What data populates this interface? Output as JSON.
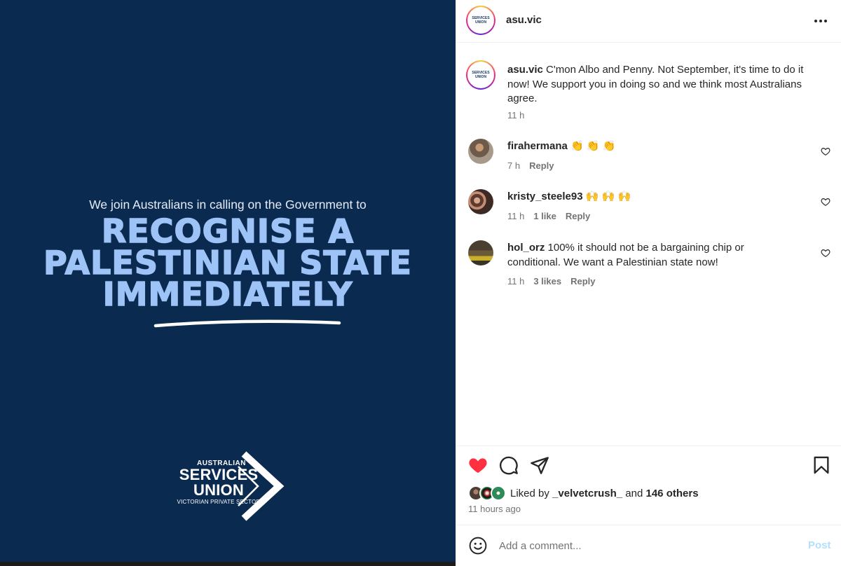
{
  "image": {
    "intro": "We join Australians in calling on the Government to",
    "headline": [
      "RECOGNISE A",
      "PALESTINIAN STATE",
      "IMMEDIATELY"
    ],
    "logo": {
      "line1": "AUSTRALIAN",
      "line2": "SERVICES",
      "line3": "UNION",
      "line4": "VICTORIAN PRIVATE SECTOR"
    },
    "colors": {
      "background": "#0b2a4f",
      "headline": "#9ec3f7"
    }
  },
  "header": {
    "username": "asu.vic",
    "more_icon": "more-horizontal-icon"
  },
  "caption": {
    "username": "asu.vic",
    "text": "C'mon Albo and Penny. Not September, it's time to do it now! We support you in doing so and we think most Australians agree.",
    "time": "11 h"
  },
  "comments": [
    {
      "username": "firahermana",
      "text": "👏 👏 👏",
      "time": "7 h",
      "likes": "",
      "reply": "Reply"
    },
    {
      "username": "kristy_steele93",
      "text": "🙌 🙌 🙌",
      "time": "11 h",
      "likes": "1 like",
      "reply": "Reply"
    },
    {
      "username": "hol_orz",
      "text": "100% it should not be a bargaining chip or conditional. We want a Palestinian state now!",
      "time": "11 h",
      "likes": "3 likes",
      "reply": "Reply"
    }
  ],
  "actions": {
    "liked_by_prefix": "Liked by",
    "liked_by_user": "_velvetcrush_",
    "liked_by_and": "and",
    "liked_by_others": "146 others",
    "time_ago": "11 hours ago",
    "like_color": "#ff3040"
  },
  "composer": {
    "placeholder": "Add a comment...",
    "post_label": "Post"
  }
}
